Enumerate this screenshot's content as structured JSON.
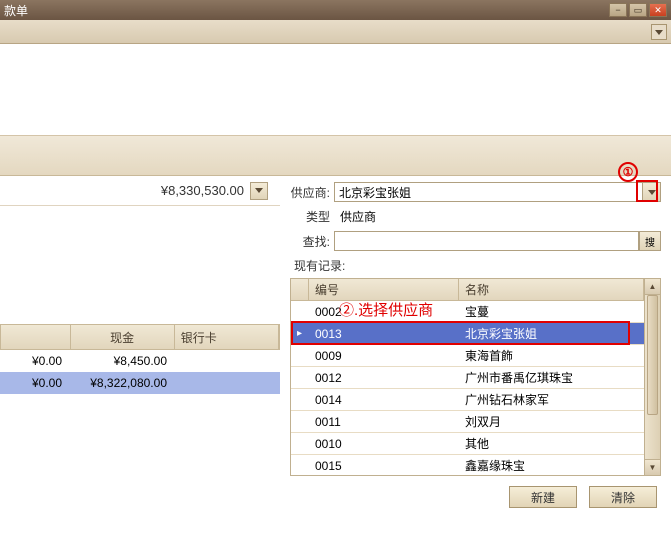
{
  "window": {
    "title": "款单",
    "min": "−",
    "max": "▭",
    "close": "✕"
  },
  "left": {
    "big_amount": "¥8,330,530.00",
    "columns": {
      "c2": "现金",
      "c3": "银行卡"
    },
    "rows": [
      {
        "c1": "¥0.00",
        "c2": "¥8,450.00",
        "c3": ""
      },
      {
        "c1": "¥0.00",
        "c2": "¥8,322,080.00",
        "c3": ""
      }
    ]
  },
  "right": {
    "supplier_label": "供应商:",
    "supplier_value": "北京彩宝张姐",
    "type_label": "类型",
    "type_value": "供应商",
    "find_label": "查找:",
    "find_value": "",
    "search_btn": "搜",
    "records_label": "现有记录:",
    "grid_headers": {
      "code": "编号",
      "name": "名称"
    },
    "records": [
      {
        "code": "0002",
        "name": "宝蔓",
        "sel": false
      },
      {
        "code": "0013",
        "name": "北京彩宝张姐",
        "sel": true
      },
      {
        "code": "0009",
        "name": "東海首飾",
        "sel": false
      },
      {
        "code": "0012",
        "name": "广州市番禹亿琪珠宝",
        "sel": false
      },
      {
        "code": "0014",
        "name": "广州钻石林家军",
        "sel": false
      },
      {
        "code": "0011",
        "name": "刘双月",
        "sel": false
      },
      {
        "code": "0010",
        "name": "其他",
        "sel": false
      },
      {
        "code": "0015",
        "name": "鑫嘉缘珠宝",
        "sel": false
      }
    ],
    "new_btn": "新建",
    "clear_btn": "清除"
  },
  "annotations": {
    "circle1": "①",
    "step2": "②.选择供应商"
  }
}
